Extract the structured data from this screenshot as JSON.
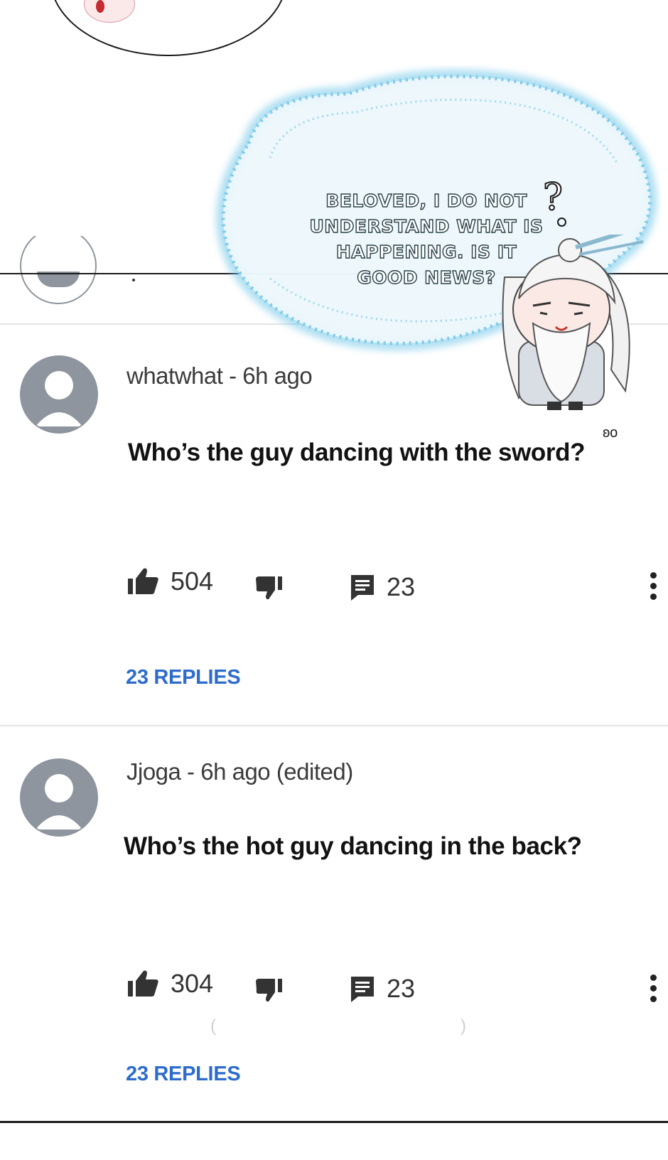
{
  "overlay": {
    "speech_lines": [
      "BELOVED, I DO NOT",
      "UNDERSTAND WHAT IS",
      "HAPPENING. IS IT",
      "GOOD NEWS?"
    ],
    "question_mark": "?",
    "sweat_marks": "ʚo"
  },
  "comments": [
    {
      "meta": "whatwhat - 6h ago",
      "text": "Who’s the guy dancing with the sword?",
      "likes": "504",
      "reply_count": "23",
      "replies_label": "23 REPLIES"
    },
    {
      "meta": "Jjoga - 6h ago (edited)",
      "text": "Who’s the hot guy dancing in the back?",
      "likes": "304",
      "reply_count": "23",
      "replies_label": "23 REPLIES"
    }
  ],
  "decor": {
    "left_glyph": "(",
    "right_glyph": ")"
  },
  "icons": {
    "like": "thumbs-up-icon",
    "dislike": "thumbs-down-icon",
    "reply": "comment-icon",
    "more": "more-vertical-icon",
    "avatar": "default-avatar-icon"
  },
  "colors": {
    "reply_link": "#2e6ccc",
    "avatar_gray": "#8e959e",
    "bubble_glow": "#6fc6e8"
  }
}
